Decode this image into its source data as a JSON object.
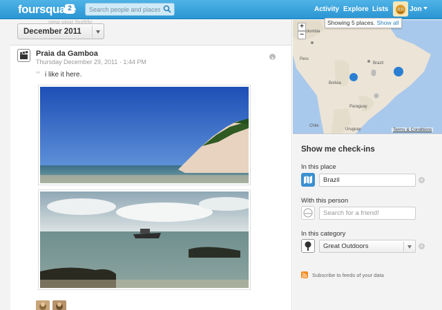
{
  "header": {
    "logo": "foursquare",
    "notifications": "2",
    "search_placeholder": "Search people and places...",
    "nav": [
      "Activity",
      "Explore",
      "Lists"
    ],
    "user": "Jon"
  },
  "feed": {
    "faded_text": "... new year buddy.",
    "month": "December 2011",
    "checkin": {
      "venue": "Praia da Gamboa",
      "date": "Thursday December 29, 2011 · 1:44 PM",
      "shout": "i like it here."
    }
  },
  "map": {
    "tooltip": "Showing 5 places.",
    "show_all": "Show all",
    "terms": "Terms & Conditions",
    "zoom_in": "+",
    "zoom_out": "−",
    "labels": [
      "Colombia",
      "Peru",
      "Brazil",
      "Bolivia",
      "Paraguay",
      "Chile",
      "Uruguay"
    ]
  },
  "sidebar": {
    "title": "Show me check-ins",
    "place_label": "In this place",
    "place_value": "Brazil",
    "person_label": "With this person",
    "person_placeholder": "Search for a friend!",
    "category_label": "In this category",
    "category_value": "Great Outdoors",
    "subscribe": "Subscribe to feeds of your data"
  },
  "colors": {
    "topbar": "#2a95d3",
    "map_water": "#a9c9ec",
    "map_land": "#ece4d6",
    "map_marker": "#2a7fd3",
    "rss": "#f28c1e"
  }
}
